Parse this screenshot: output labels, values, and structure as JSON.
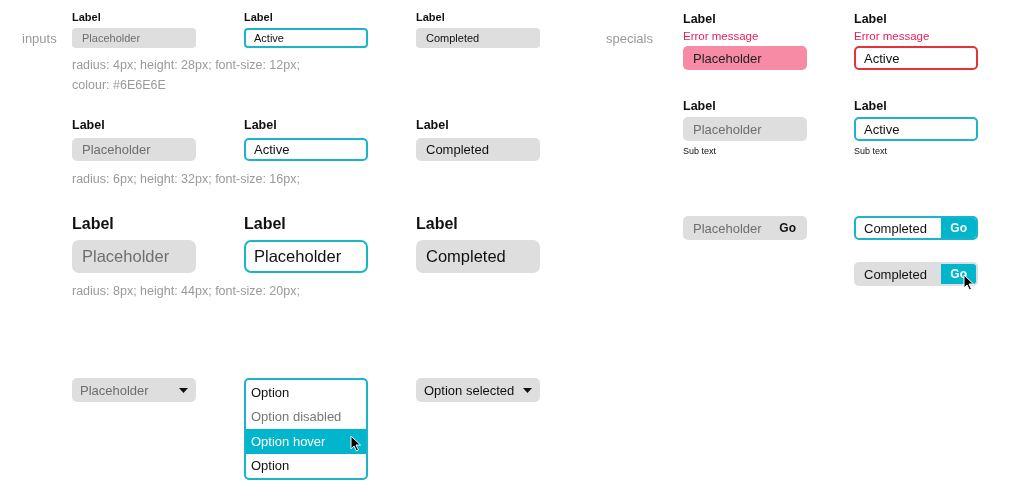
{
  "sections": [
    {
      "title": "inputs",
      "groups": [
        {
          "kind": "small",
          "fields": [
            {
              "label": "Label",
              "filled": false,
              "focused": false,
              "text": "Placeholder"
            },
            {
              "label": "Label",
              "filled": true,
              "focused": true,
              "text": "Active"
            },
            {
              "label": "Label",
              "filled": true,
              "focused": false,
              "text": "Completed"
            }
          ],
          "note": "radius: 4px; height: 28px; font-size: 12px; colour: #6E6E6E"
        },
        {
          "kind": "medium",
          "fields": [
            {
              "label": "Label",
              "filled": false,
              "focused": false,
              "text": "Placeholder"
            },
            {
              "label": "Label",
              "filled": true,
              "focused": true,
              "text": "Active"
            },
            {
              "label": "Label",
              "filled": true,
              "focused": false,
              "text": "Completed"
            }
          ],
          "note": "radius: 6px; height: 32px; font-size: 16px;"
        },
        {
          "kind": "large",
          "fields": [
            {
              "label": "Label",
              "filled": false,
              "focused": false,
              "text": "Placeholder"
            },
            {
              "label": "Label",
              "filled": true,
              "focused": true,
              "text": "Placeholder"
            },
            {
              "label": "Label",
              "filled": true,
              "focused": false,
              "text": "Completed"
            }
          ],
          "note": "radius: 8px; height: 44px; font-size: 20px;"
        }
      ],
      "dropdowns": [
        {
          "kind": "select",
          "filled": false,
          "text": "Placeholder"
        },
        {
          "kind": "list",
          "options": [
            {
              "text": "Option",
              "disabled": false,
              "hovered": false
            },
            {
              "text": "Option disabled",
              "disabled": true,
              "hovered": false
            },
            {
              "text": "Option hover",
              "disabled": false,
              "hovered": true
            },
            {
              "text": "Option",
              "disabled": false,
              "hovered": false
            }
          ]
        },
        {
          "kind": "select",
          "filled": true,
          "text": "Option selected"
        }
      ]
    },
    {
      "title": "specials",
      "columns": [
        {
          "items": [
            {
              "kind": "error",
              "label": "Label",
              "error": "Error message",
              "focused": false,
              "text": "Placeholder"
            },
            {
              "kind": "subtext",
              "label": "Label",
              "filled": false,
              "focused": false,
              "text": "Placeholder",
              "sub": "Sub text"
            },
            {
              "kind": "go",
              "filled": false,
              "focused": false,
              "text": "Placeholder",
              "button": {
                "text": "Go",
                "filled": false,
                "hovered": false
              }
            }
          ]
        },
        {
          "items": [
            {
              "kind": "error",
              "label": "Label",
              "error": "Error message",
              "focused": true,
              "text": "Active"
            },
            {
              "kind": "subtext",
              "label": "Label",
              "filled": true,
              "focused": true,
              "text": "Active",
              "sub": "Sub text"
            },
            {
              "kind": "go",
              "filled": true,
              "focused": true,
              "text": "Completed",
              "button": {
                "text": "Go",
                "filled": true,
                "hovered": false
              }
            },
            {
              "kind": "go",
              "filled": true,
              "focused": false,
              "text": "Completed",
              "button": {
                "text": "Go",
                "filled": true,
                "hovered": true
              }
            }
          ]
        }
      ]
    }
  ]
}
